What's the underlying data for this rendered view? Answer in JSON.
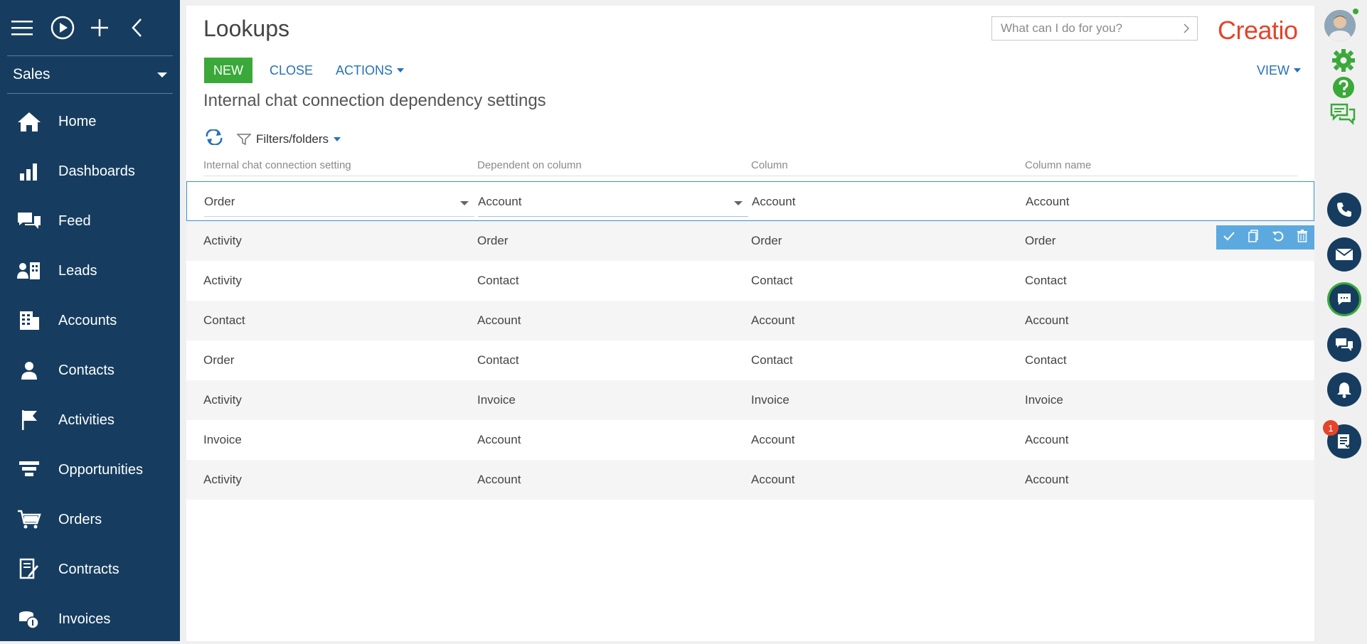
{
  "sidebar": {
    "workspace": "Sales",
    "items": [
      {
        "label": "Home",
        "icon": "home-icon"
      },
      {
        "label": "Dashboards",
        "icon": "dashboards-icon"
      },
      {
        "label": "Feed",
        "icon": "feed-icon"
      },
      {
        "label": "Leads",
        "icon": "leads-icon"
      },
      {
        "label": "Accounts",
        "icon": "accounts-icon"
      },
      {
        "label": "Contacts",
        "icon": "contacts-icon"
      },
      {
        "label": "Activities",
        "icon": "flag-icon"
      },
      {
        "label": "Opportunities",
        "icon": "funnel-icon"
      },
      {
        "label": "Orders",
        "icon": "cart-icon"
      },
      {
        "label": "Contracts",
        "icon": "contract-icon"
      },
      {
        "label": "Invoices",
        "icon": "invoice-icon"
      }
    ]
  },
  "header": {
    "title": "Lookups",
    "search_placeholder": "What can I do for you?",
    "logo": "Creatio"
  },
  "toolbar": {
    "new_label": "NEW",
    "close_label": "CLOSE",
    "actions_label": "ACTIONS",
    "view_label": "VIEW",
    "filters_label": "Filters/folders"
  },
  "section_title": "Internal chat connection dependency settings",
  "grid": {
    "columns": [
      "Internal chat connection setting",
      "Dependent on column",
      "Column",
      "Column name"
    ],
    "rows": [
      [
        "Order",
        "Account",
        "Account",
        "Account"
      ],
      [
        "Activity",
        "Order",
        "Order",
        "Order"
      ],
      [
        "Activity",
        "Contact",
        "Contact",
        "Contact"
      ],
      [
        "Contact",
        "Account",
        "Account",
        "Account"
      ],
      [
        "Order",
        "Contact",
        "Contact",
        "Contact"
      ],
      [
        "Activity",
        "Invoice",
        "Invoice",
        "Invoice"
      ],
      [
        "Invoice",
        "Account",
        "Account",
        "Account"
      ],
      [
        "Activity",
        "Account",
        "Account",
        "Account"
      ]
    ]
  },
  "rail": {
    "notifications_count": "1"
  },
  "colors": {
    "sidebar": "#163d5f",
    "accent_green": "#3aa93a",
    "link_blue": "#2671b7",
    "brand_red": "#e4442b"
  }
}
